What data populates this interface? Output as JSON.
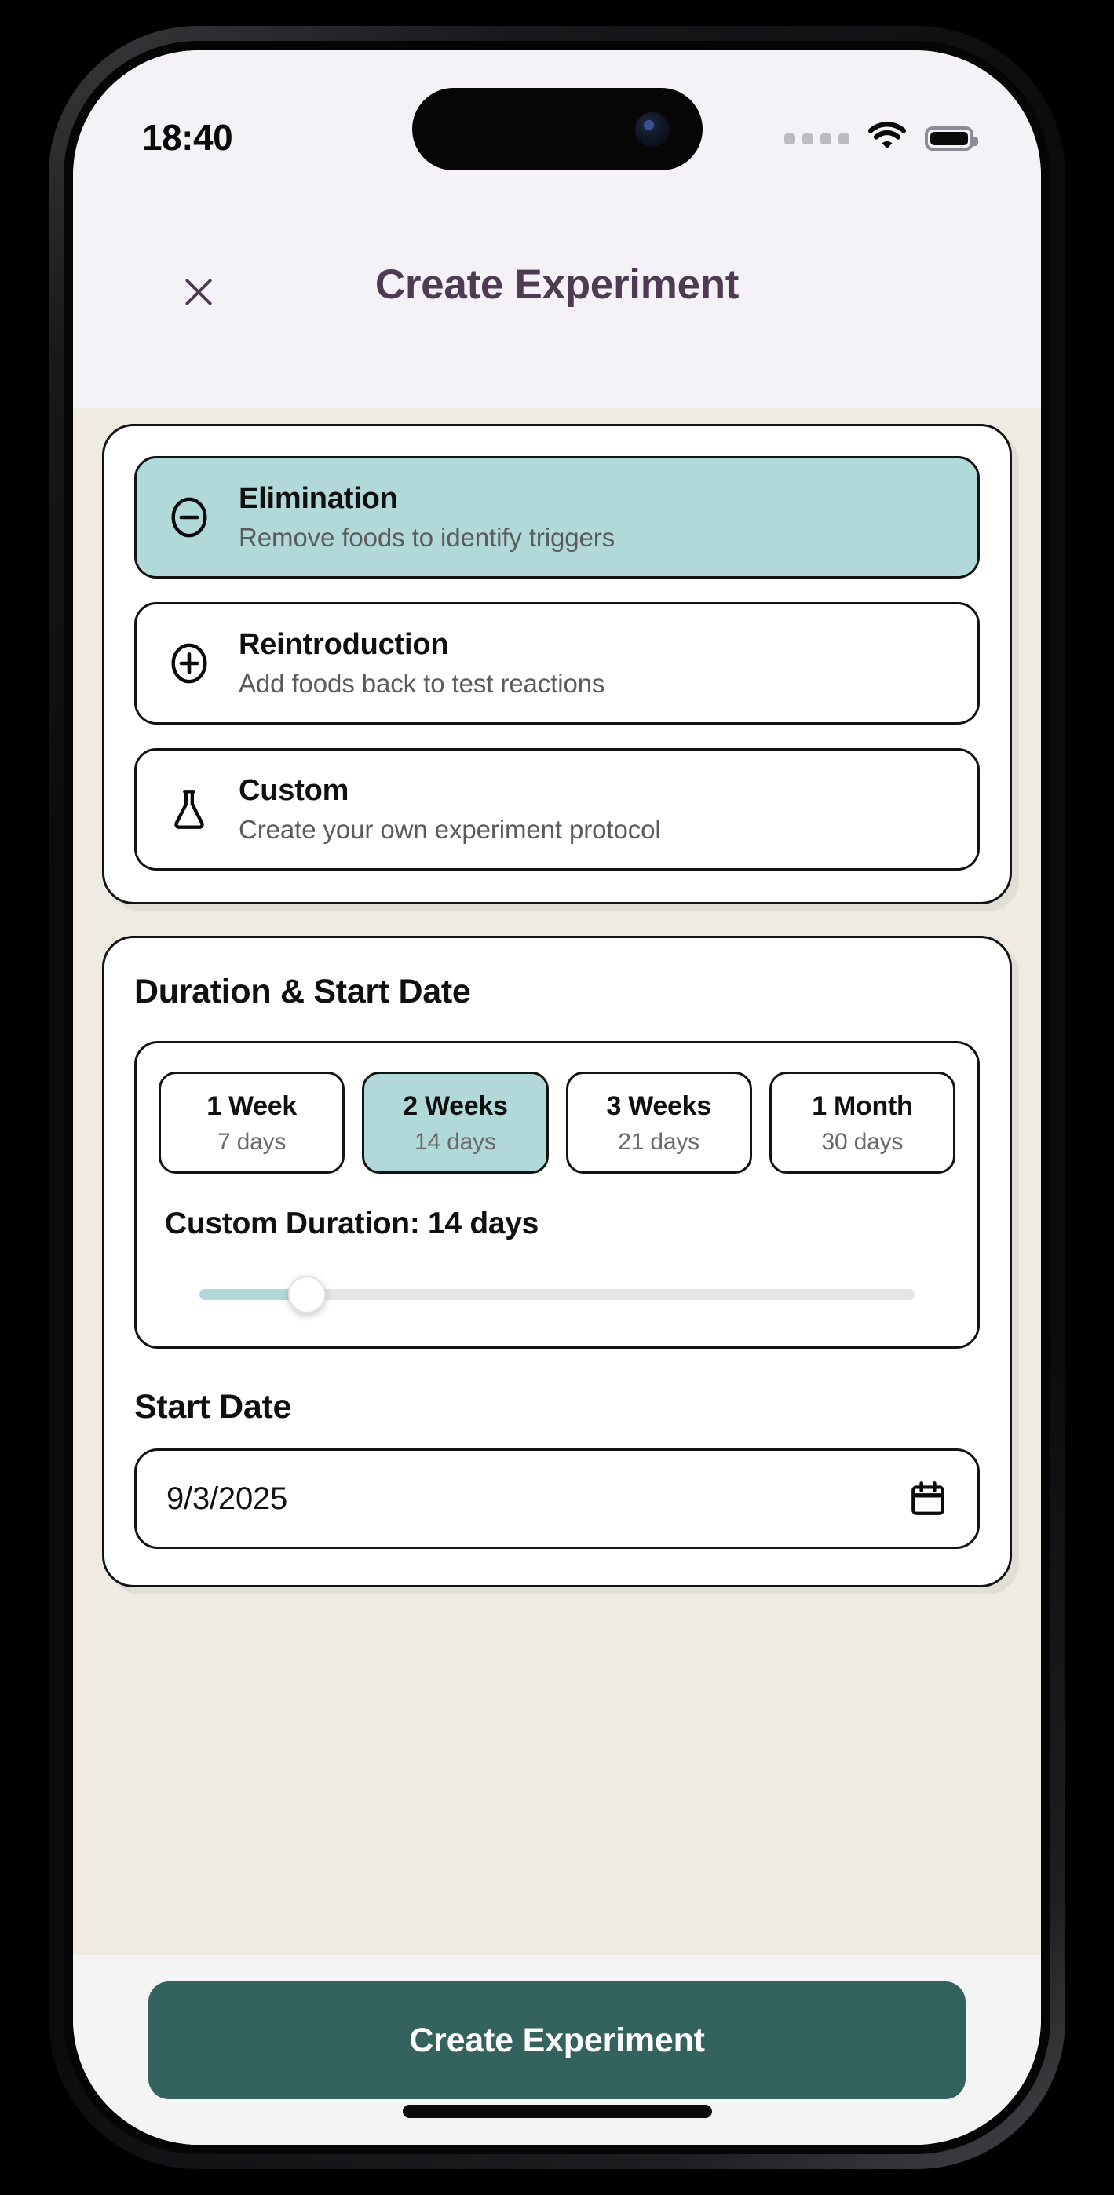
{
  "status_bar": {
    "time": "18:40",
    "signal_icon": "signal-dots-icon",
    "wifi_icon": "wifi-icon",
    "battery_icon": "battery-full-icon"
  },
  "header": {
    "close_icon": "close-x-icon",
    "title": "Create Experiment"
  },
  "experiment_types": [
    {
      "icon": "minus-circle-icon",
      "title": "Elimination",
      "description": "Remove foods to identify triggers",
      "selected": true
    },
    {
      "icon": "plus-circle-icon",
      "title": "Reintroduction",
      "description": "Add foods back to test reactions",
      "selected": false
    },
    {
      "icon": "flask-icon",
      "title": "Custom",
      "description": "Create your own experiment protocol",
      "selected": false
    }
  ],
  "duration_section": {
    "heading": "Duration & Start Date",
    "chips": [
      {
        "label": "1 Week",
        "sub": "7 days",
        "selected": false
      },
      {
        "label": "2 Weeks",
        "sub": "14 days",
        "selected": true
      },
      {
        "label": "3 Weeks",
        "sub": "21 days",
        "selected": false
      },
      {
        "label": "1 Month",
        "sub": "30 days",
        "selected": false
      }
    ],
    "custom_duration_label": "Custom Duration: 14 days",
    "slider": {
      "value": 14,
      "min": 1,
      "max": 90,
      "percent": 15
    }
  },
  "start_date_section": {
    "heading": "Start Date",
    "value": "9/3/2025",
    "calendar_icon": "calendar-icon"
  },
  "bottom_bar": {
    "primary_button_label": "Create Experiment"
  },
  "colors": {
    "accent_teal": "#B2D9D9",
    "primary_button": "#33625F",
    "page_background": "#EFEBE2",
    "header_background": "#F4F1F7",
    "title_color": "#4E3B53"
  }
}
